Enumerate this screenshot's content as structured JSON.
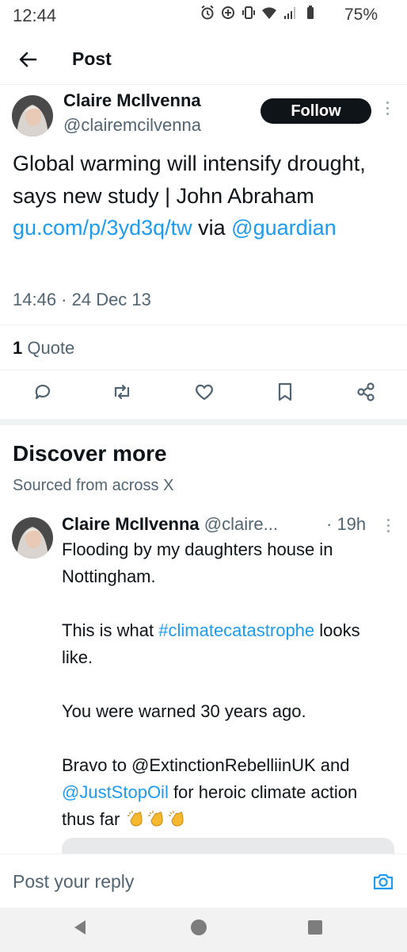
{
  "status_bar": {
    "time": "12:44",
    "battery": "75%",
    "icons": [
      "alarm-icon",
      "data-saver-icon",
      "vibrate-icon",
      "wifi-icon",
      "signal-icon",
      "battery-icon"
    ]
  },
  "header": {
    "title": "Post",
    "back_icon": "back-arrow-icon"
  },
  "post": {
    "author_name": "Claire McIlvenna",
    "author_handle": "@clairemcilvenna",
    "follow_label": "Follow",
    "text_part1": "Global warming will intensify drought, says new study | John Abraham ",
    "link_url": "gu.com/p/3yd3q/tw",
    "text_part2": " via ",
    "mention": "@guardian",
    "timestamp": "14:46 · 24 Dec 13",
    "quote_count": "1",
    "quote_label": " Quote",
    "actions": [
      "reply-icon",
      "repost-icon",
      "like-icon",
      "bookmark-icon",
      "share-icon"
    ]
  },
  "discover": {
    "title": "Discover more",
    "subtitle": "Sourced from across X",
    "tweet": {
      "author_name": "Claire McIlvenna",
      "author_handle": "@claire...",
      "time": "· 19h",
      "line1": "Flooding by my daughters house in Nottingham.",
      "line2_prefix": "This is what ",
      "hashtag": "#climatecatastrophe",
      "line2_suffix": " looks like.",
      "line3": "You were warned 30 years ago.",
      "line4_prefix": "Bravo to @ExtinctionRebelliinUK and ",
      "mention": "@JustStopOil",
      "line4_suffix": " for heroic climate action thus far"
    }
  },
  "reply": {
    "placeholder": "Post your reply",
    "camera_icon": "camera-icon"
  },
  "colors": {
    "accent": "#1d9bf0",
    "text_primary": "#0f1419",
    "text_secondary": "#536471",
    "follow_bg": "#0f1419"
  }
}
